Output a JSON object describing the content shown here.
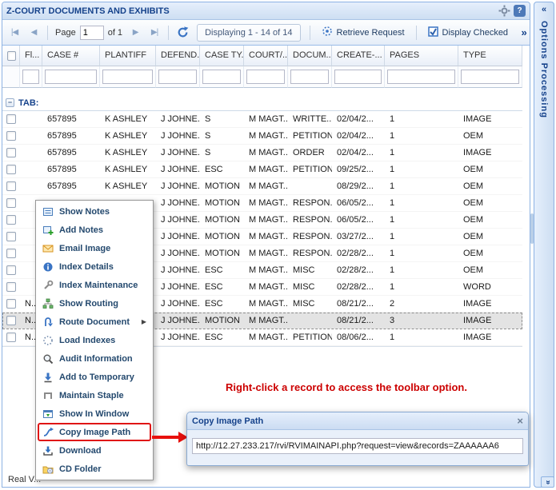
{
  "window": {
    "title": "Z-COURT DOCUMENTS AND EXHIBITS"
  },
  "icons": {
    "first": "|◀",
    "prev": "◀",
    "next": "▶",
    "last": "▶|",
    "overflow": "»",
    "collapse_left": "«",
    "collapse_bottom": "«",
    "group_collapse": "−",
    "help": "?",
    "close": "×",
    "submenu_arrow": "▶"
  },
  "toolbar": {
    "page_label": "Page",
    "page_value": "1",
    "of_label": "of 1",
    "displaying_text": "Displaying 1 - 14 of 14",
    "retrieve_request_label": "Retrieve Request",
    "display_checked_label": "Display Checked"
  },
  "grid": {
    "group_label": "TAB:",
    "columns": [
      "Fl...",
      "CASE #",
      "PLANTIFF",
      "DEFEND...",
      "CASE TY...",
      "COURT/...",
      "DOCUM...",
      "CREATE-...",
      "PAGES",
      "TYPE"
    ],
    "rows": [
      {
        "flag": "",
        "case_no": "657895",
        "plaintiff": "K ASHLEY",
        "defendant": "J JOHNE...",
        "case_type": "S",
        "court": "M MAGT...",
        "document": "WRITTE...",
        "created": "02/04/2...",
        "pages": "1",
        "type": "IMAGE"
      },
      {
        "flag": "",
        "case_no": "657895",
        "plaintiff": "K ASHLEY",
        "defendant": "J JOHNE...",
        "case_type": "S",
        "court": "M MAGT...",
        "document": "PETITION",
        "created": "02/04/2...",
        "pages": "1",
        "type": "OEM"
      },
      {
        "flag": "",
        "case_no": "657895",
        "plaintiff": "K ASHLEY",
        "defendant": "J JOHNE...",
        "case_type": "S",
        "court": "M MAGT...",
        "document": "ORDER",
        "created": "02/04/2...",
        "pages": "1",
        "type": "IMAGE"
      },
      {
        "flag": "",
        "case_no": "657895",
        "plaintiff": "K ASHLEY",
        "defendant": "J JOHNE...",
        "case_type": "ESC",
        "court": "M MAGT...",
        "document": "PETITION",
        "created": "09/25/2...",
        "pages": "1",
        "type": "OEM"
      },
      {
        "flag": "",
        "case_no": "657895",
        "plaintiff": "K ASHLEY",
        "defendant": "J JOHNE...",
        "case_type": "MOTION",
        "court": "M MAGT...",
        "document": "",
        "created": "08/29/2...",
        "pages": "1",
        "type": "OEM"
      },
      {
        "flag": "",
        "case_no": "",
        "plaintiff": "",
        "defendant": "J JOHNE...",
        "case_type": "MOTION",
        "court": "M MAGT...",
        "document": "RESPON...",
        "created": "06/05/2...",
        "pages": "1",
        "type": "OEM"
      },
      {
        "flag": "",
        "case_no": "",
        "plaintiff": "",
        "defendant": "J JOHNE...",
        "case_type": "MOTION",
        "court": "M MAGT...",
        "document": "RESPON...",
        "created": "06/05/2...",
        "pages": "1",
        "type": "OEM"
      },
      {
        "flag": "",
        "case_no": "",
        "plaintiff": "",
        "defendant": "J JOHNE...",
        "case_type": "MOTION",
        "court": "M MAGT...",
        "document": "RESPON...",
        "created": "03/27/2...",
        "pages": "1",
        "type": "OEM"
      },
      {
        "flag": "",
        "case_no": "",
        "plaintiff": "",
        "defendant": "J JOHNE...",
        "case_type": "MOTION",
        "court": "M MAGT...",
        "document": "RESPON...",
        "created": "02/28/2...",
        "pages": "1",
        "type": "OEM"
      },
      {
        "flag": "",
        "case_no": "",
        "plaintiff": "",
        "defendant": "J JOHNE...",
        "case_type": "ESC",
        "court": "M MAGT...",
        "document": "MISC",
        "created": "02/28/2...",
        "pages": "1",
        "type": "OEM"
      },
      {
        "flag": "",
        "case_no": "",
        "plaintiff": "",
        "defendant": "J JOHNE...",
        "case_type": "ESC",
        "court": "M MAGT...",
        "document": "MISC",
        "created": "02/28/2...",
        "pages": "1",
        "type": "WORD"
      },
      {
        "flag": "N...",
        "case_no": "",
        "plaintiff": "",
        "defendant": "J JOHNE...",
        "case_type": "ESC",
        "court": "M MAGT...",
        "document": "MISC",
        "created": "08/21/2...",
        "pages": "2",
        "type": "IMAGE"
      },
      {
        "flag": "N...",
        "case_no": "",
        "plaintiff": "",
        "defendant": "J JOHNE...",
        "case_type": "MOTION",
        "court": "M MAGT...",
        "document": "",
        "created": "08/21/2...",
        "pages": "3",
        "type": "IMAGE",
        "selected": true
      },
      {
        "flag": "N...",
        "case_no": "",
        "plaintiff": "",
        "defendant": "J JOHNE...",
        "case_type": "ESC",
        "court": "M MAGT...",
        "document": "PETITION",
        "created": "08/06/2...",
        "pages": "1",
        "type": "IMAGE"
      }
    ]
  },
  "context_menu": {
    "items": [
      {
        "label": "Show Notes",
        "icon": "show-notes-icon"
      },
      {
        "label": "Add Notes",
        "icon": "add-notes-icon"
      },
      {
        "label": "Email Image",
        "icon": "email-image-icon"
      },
      {
        "label": "Index Details",
        "icon": "index-details-icon"
      },
      {
        "label": "Index Maintenance",
        "icon": "index-maintenance-icon"
      },
      {
        "label": "Show Routing",
        "icon": "show-routing-icon"
      },
      {
        "label": "Route Document",
        "icon": "route-document-icon",
        "submenu": true
      },
      {
        "label": "Load Indexes",
        "icon": "load-indexes-icon"
      },
      {
        "label": "Audit Information",
        "icon": "audit-information-icon"
      },
      {
        "label": "Add to Temporary",
        "icon": "add-to-temporary-icon"
      },
      {
        "label": "Maintain Staple",
        "icon": "maintain-staple-icon"
      },
      {
        "label": "Show In Window",
        "icon": "show-in-window-icon"
      },
      {
        "label": "Copy Image Path",
        "icon": "copy-image-path-icon",
        "highlighted": true
      },
      {
        "label": "Download",
        "icon": "download-icon"
      },
      {
        "label": "CD Folder",
        "icon": "cd-folder-icon"
      }
    ]
  },
  "annotation": "Right-click a record to access the toolbar option.",
  "popup": {
    "title": "Copy Image Path",
    "url": "http://12.27.233.217/rvi/RVIMAINAPI.php?request=view&records=ZAAAAAA6"
  },
  "side_panel": {
    "label": "Options Processing"
  },
  "status_bar": {
    "label": "Real V..."
  }
}
